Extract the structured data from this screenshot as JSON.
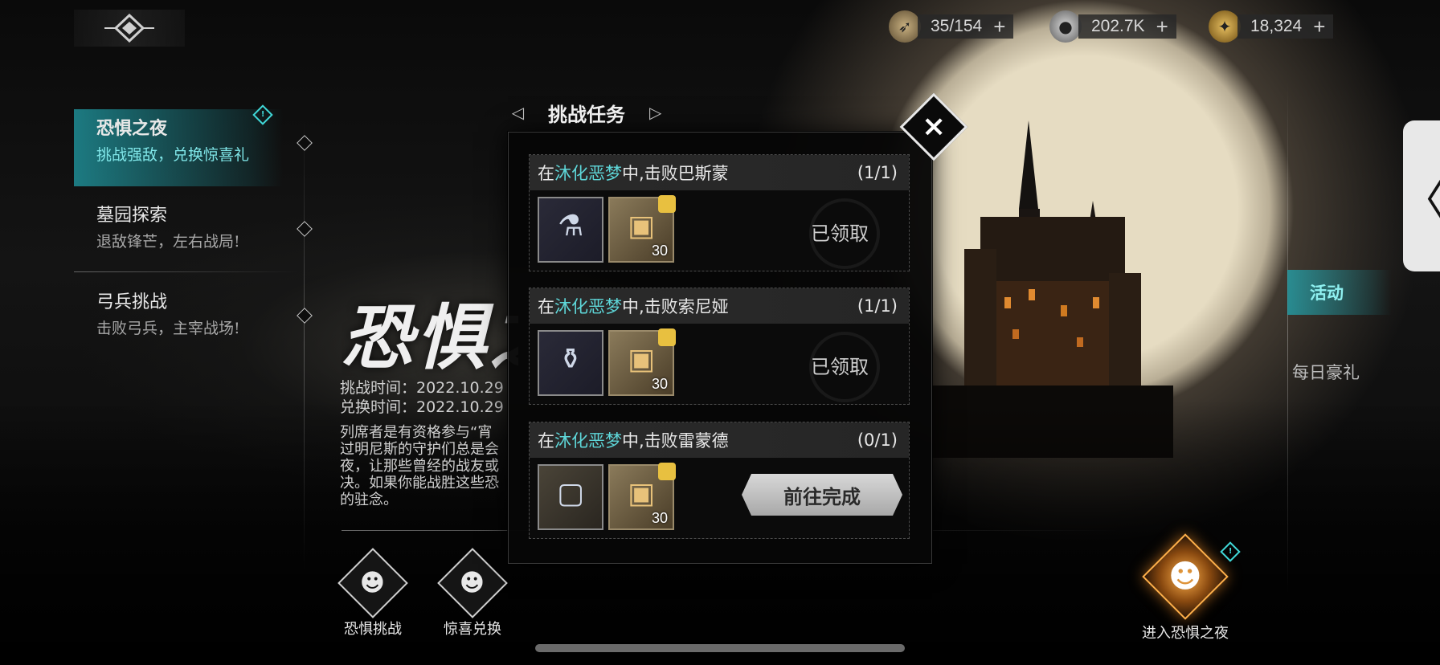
{
  "resources": [
    {
      "icon": "arrow-bundle-icon",
      "value": "35/154",
      "color": "#b49a62"
    },
    {
      "icon": "silver-coin-icon",
      "value": "202.7K",
      "color": "#8a8a8a"
    },
    {
      "icon": "gold-token-icon",
      "value": "18,324",
      "color": "#c9a447"
    }
  ],
  "plus": "+",
  "nav": [
    {
      "title": "恐惧之夜",
      "subtitle": "挑战强敌，兑换惊喜礼"
    },
    {
      "title": "墓园探索",
      "subtitle": "退敌锋芒，左右战局!"
    },
    {
      "title": "弓兵挑战",
      "subtitle": "击败弓兵，主宰战场!"
    }
  ],
  "event": {
    "title": "恐惧之",
    "challenge_time": "挑战时间：2022.10.29",
    "exchange_time": "兑换时间：2022.10.29",
    "description": [
      "列席者是有资格参与“宵",
      "过明尼斯的守护们总是会",
      "夜，让那些曾经的战友或",
      "决。如果你能战胜这些恐",
      "的驻念。"
    ]
  },
  "bottom_buttons": [
    {
      "label": "恐惧挑战",
      "icon": "pumpkin-scroll-icon"
    },
    {
      "label": "惊喜兑换",
      "icon": "pumpkin-gift-icon"
    }
  ],
  "right_tabs": {
    "active": "活动",
    "daily": "每日豪礼"
  },
  "enter_button": {
    "label": "进入恐惧之夜",
    "icon": "pumpkin-swords-icon"
  },
  "modal": {
    "title": "挑战任务",
    "close": "×",
    "tasks": [
      {
        "prefix": "在",
        "highlight": "沐化恶梦",
        "suffix": "中,击败巴斯蒙",
        "progress": "(1/1)",
        "item1": "potion-flask-icon",
        "item2_qty": "30",
        "status": "已领取",
        "done": true
      },
      {
        "prefix": "在",
        "highlight": "沐化恶梦",
        "suffix": "中,击败索尼娅",
        "progress": "(1/1)",
        "item1": "hand-cannon-icon",
        "item2_qty": "30",
        "status": "已领取",
        "done": true
      },
      {
        "prefix": "在",
        "highlight": "沐化恶梦",
        "suffix": "中,击败雷蒙德",
        "progress": "(0/1)",
        "item1": "frame-icon",
        "item2_qty": "30",
        "status": "前往完成",
        "done": false
      }
    ]
  },
  "side_handle": "〈",
  "colors": {
    "accent": "#5ed6d8",
    "moon": "#e6dcc2"
  }
}
